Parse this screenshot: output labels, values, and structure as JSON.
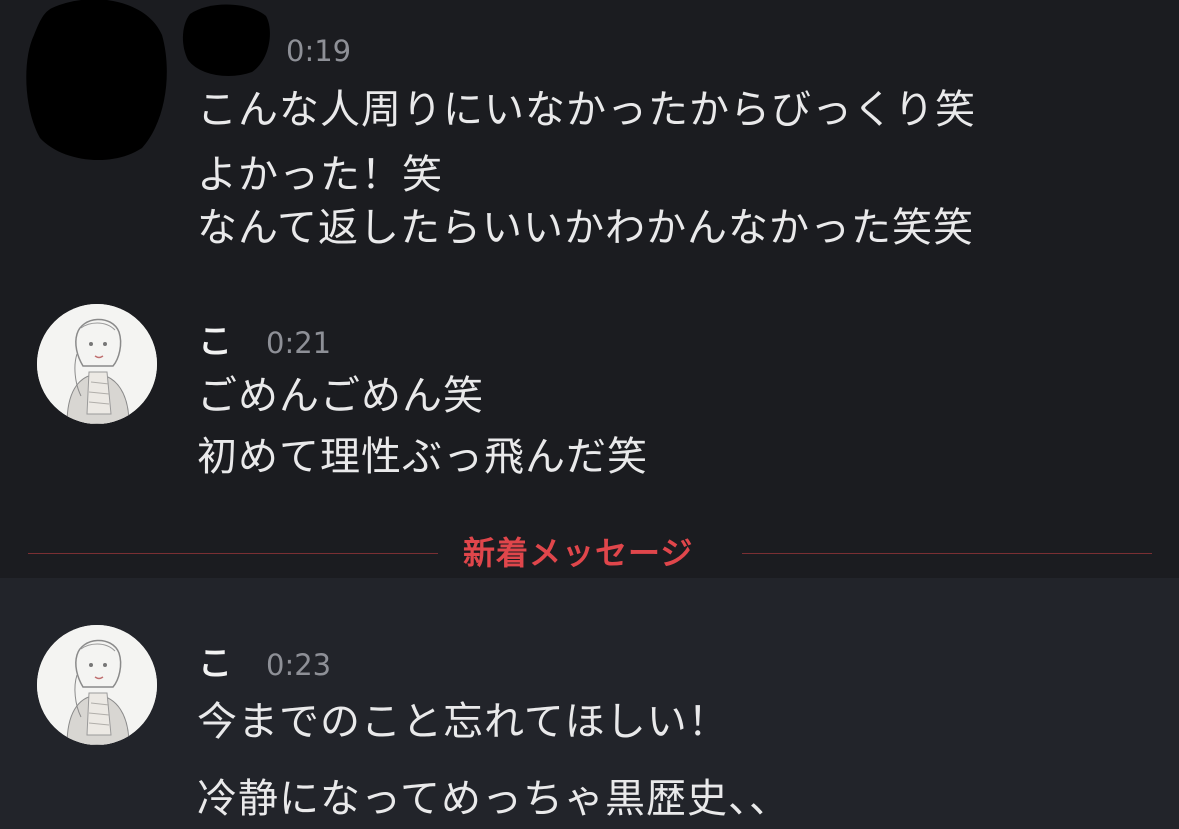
{
  "messages": [
    {
      "author": "",
      "time": "0:19",
      "lines": [
        "こんな人周りにいなかったからびっくり笑",
        "よかった！笑",
        "なんて返したらいいかわかんなかった笑笑"
      ]
    },
    {
      "author": "こ",
      "time": "0:21",
      "lines": [
        "ごめんごめん笑",
        "初めて理性ぶっ飛んだ笑"
      ]
    },
    {
      "author": "こ",
      "time": "0:23",
      "lines": [
        "今までのこと忘れてほしい！",
        "冷静になってめっちゃ黒歴史、、"
      ]
    }
  ],
  "divider": {
    "label": "新着メッセージ",
    "color": "#e0464b"
  },
  "colors": {
    "background": "#1b1c20",
    "unread_background": "#22242a",
    "text": "#e9e9ea",
    "timestamp": "#8e9097"
  }
}
